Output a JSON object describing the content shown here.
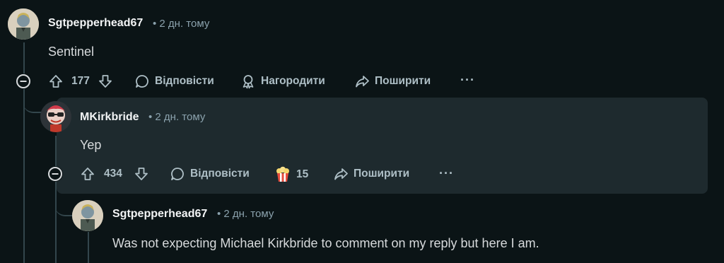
{
  "comments": [
    {
      "author": "Sgtpepperhead67",
      "time": "• 2 дн. тому",
      "text": "Sentinel",
      "votes": "177",
      "reply_label": "Відповісти",
      "award_label": "Нагородити",
      "share_label": "Поширити",
      "more_label": "···"
    },
    {
      "author": "MKirkbride",
      "time": "• 2 дн. тому",
      "text": "Yep",
      "votes": "434",
      "reply_label": "Відповісти",
      "award_count": "15",
      "share_label": "Поширити",
      "more_label": "···"
    },
    {
      "author": "Sgtpepperhead67",
      "time": "• 2 дн. тому",
      "text": "Was not expecting Michael Kirkbride to comment on my reply but here I am."
    }
  ],
  "colors": {
    "background": "#0b1416",
    "highlight": "#1e2a2e",
    "thread_line": "#33464c",
    "meta_text": "#8ba2ad"
  }
}
